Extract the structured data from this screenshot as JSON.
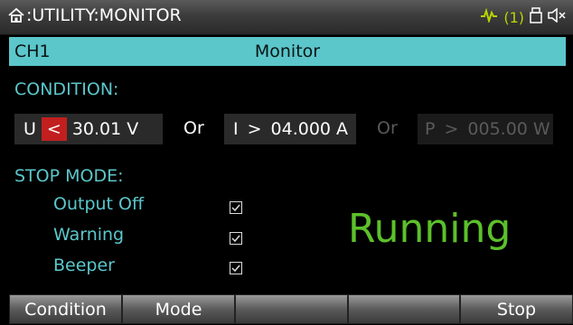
{
  "header": {
    "title": ":UTILITY:MONITOR",
    "home_icon": "home-icon",
    "alarm_count": "(1)",
    "status_icons": [
      "wave-icon",
      "usb-icon",
      "mute-icon"
    ],
    "alarm_color": "#b8d400"
  },
  "channel_bar": {
    "channel": "CH1",
    "title": "Monitor",
    "accent_color": "#5bc7cb"
  },
  "condition": {
    "label": "CONDITION:",
    "voltage": {
      "param": "U",
      "operator": "<",
      "value": "30.01 V"
    },
    "or_1": "Or",
    "current": {
      "param": "I",
      "operator": ">",
      "value": "04.000 A"
    },
    "or_2": "Or",
    "power": {
      "param": "P",
      "operator": ">",
      "value": "005.00 W",
      "enabled": false
    }
  },
  "stop_mode": {
    "label": "STOP MODE:",
    "items": [
      {
        "label": "Output Off",
        "checked": true
      },
      {
        "label": "Warning",
        "checked": true
      },
      {
        "label": "Beeper",
        "checked": true
      }
    ]
  },
  "status": {
    "text": "Running",
    "color": "#5cc02a"
  },
  "softkeys": [
    "Condition",
    "Mode",
    "",
    "",
    "Stop"
  ]
}
